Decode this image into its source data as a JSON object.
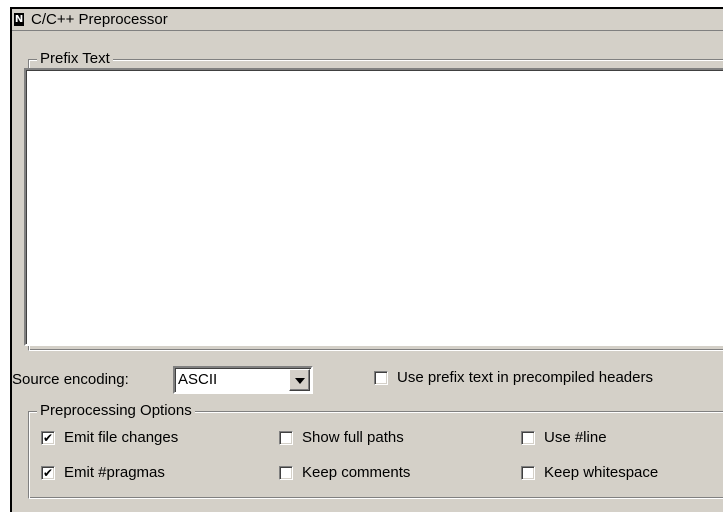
{
  "panel": {
    "title": "C/C++ Preprocessor",
    "icon": "panel-icon"
  },
  "prefix": {
    "legend": "Prefix Text",
    "value": ""
  },
  "encoding": {
    "label": "Source encoding:",
    "selected": "ASCII"
  },
  "precompiled": {
    "label": "Use prefix text in precompiled headers",
    "checked": false
  },
  "options": {
    "legend": "Preprocessing Options",
    "items": [
      {
        "label": "Emit file changes",
        "checked": true
      },
      {
        "label": "Show full paths",
        "checked": false
      },
      {
        "label": "Use #line",
        "checked": false
      },
      {
        "label": "Emit #pragmas",
        "checked": true
      },
      {
        "label": "Keep comments",
        "checked": false
      },
      {
        "label": "Keep whitespace",
        "checked": false
      }
    ]
  }
}
